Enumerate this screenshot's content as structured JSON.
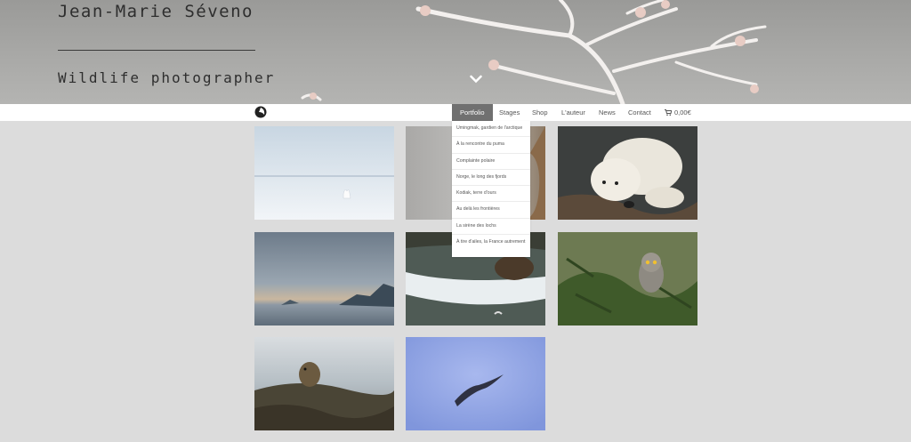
{
  "hero": {
    "title": "Jean-Marie Séveno",
    "subtitle": "Wildlife photographer"
  },
  "nav": {
    "items": [
      {
        "label": "Portfolio",
        "active": true
      },
      {
        "label": "Stages"
      },
      {
        "label": "Shop"
      },
      {
        "label": "L'auteur"
      },
      {
        "label": "News"
      },
      {
        "label": "Contact"
      }
    ],
    "cart": {
      "label": "0,00€",
      "icon": "cart-icon"
    }
  },
  "dropdown": {
    "items": [
      "Umingmak, gardien de l'arctique",
      "À la rencontre du puma",
      "Complainte polaire",
      "Norge, le long des fjords",
      "Kodiak, terre d'ours",
      "Au delà les frontières",
      "La sirène des lochs",
      "À tire d'ailes, la France autrement"
    ]
  },
  "gallery": {
    "items": [
      {
        "subject": "arctic fox on snow"
      },
      {
        "subject": "puma"
      },
      {
        "subject": "polar bear resting"
      },
      {
        "subject": "norwegian fjord"
      },
      {
        "subject": "kodiak bear in water"
      },
      {
        "subject": "great grey owl"
      },
      {
        "subject": "otter on rocks"
      },
      {
        "subject": "bird in flight"
      }
    ]
  },
  "colors": {
    "background": "#dcdcdc",
    "nav_active": "#707070",
    "hero_text": "#2e2e2e"
  }
}
